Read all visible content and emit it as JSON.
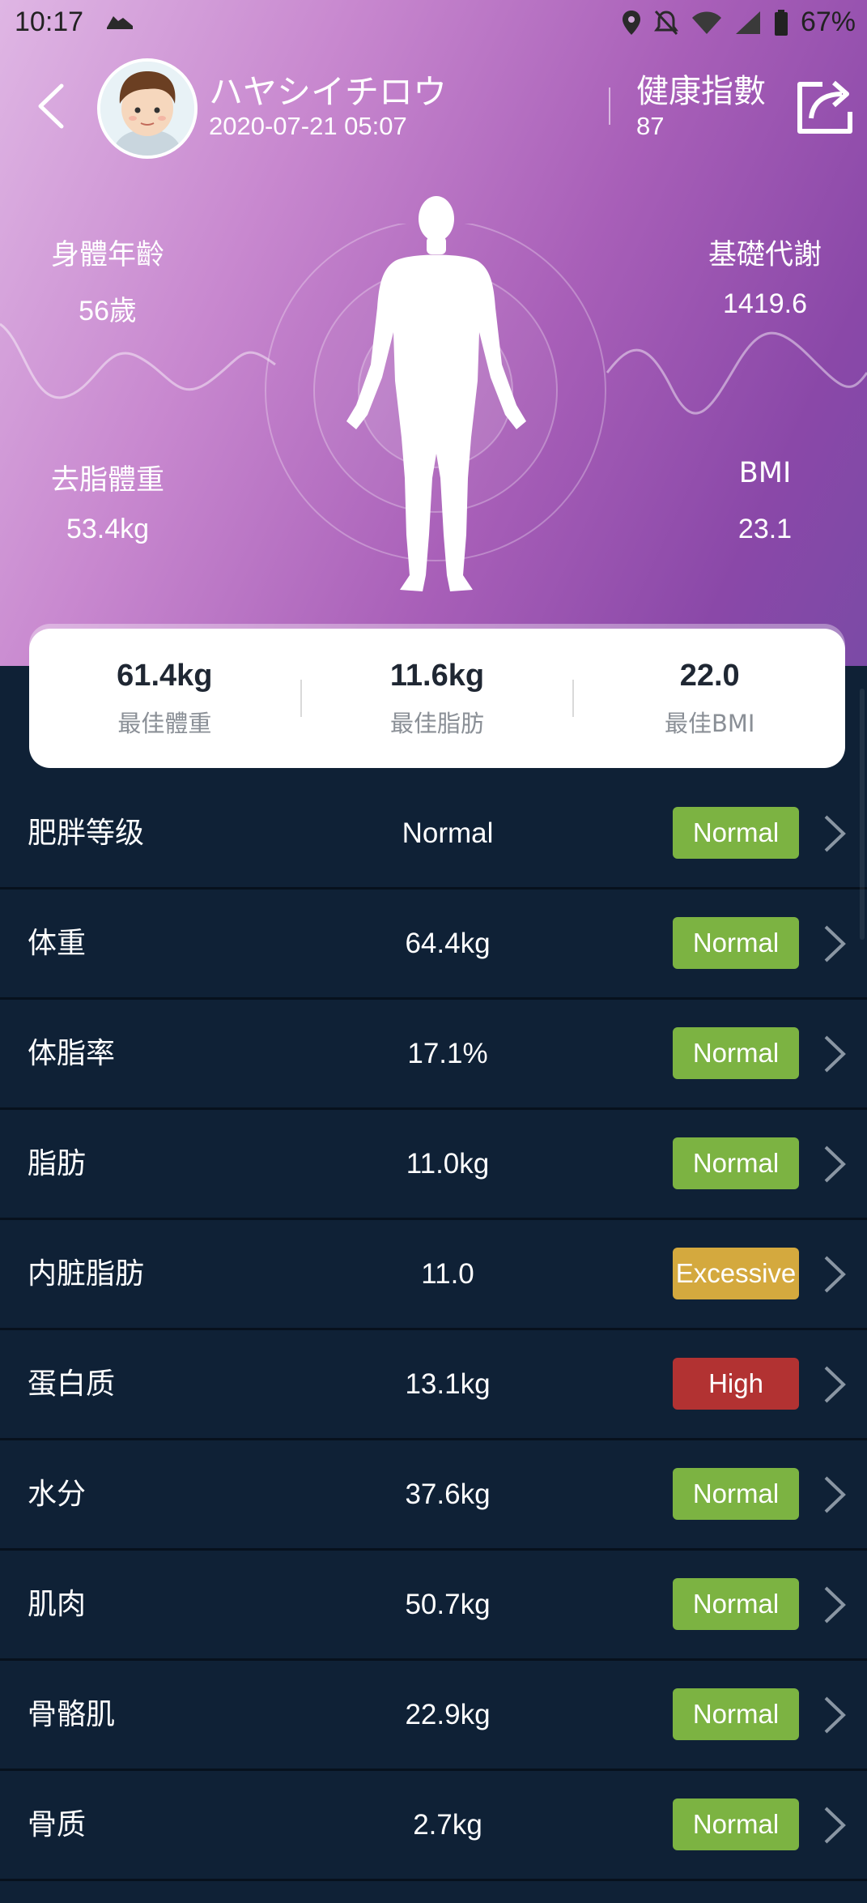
{
  "status_bar": {
    "time": "10:17",
    "battery": "67%",
    "icons": [
      "running-shoe-icon",
      "location-icon",
      "mute-icon",
      "wifi-icon",
      "signal-icon",
      "battery-icon"
    ]
  },
  "header": {
    "user_name": "ハヤシイチロウ",
    "date": "2020-07-21 05:07",
    "health_label": "健康指數",
    "health_value": "87"
  },
  "metrics": {
    "body_age": {
      "label": "身體年齡",
      "value": "56歲"
    },
    "bmr": {
      "label": "基礎代謝",
      "value": "1419.6"
    },
    "lean_mass": {
      "label": "去脂體重",
      "value": "53.4kg"
    },
    "bmi": {
      "label": "BMI",
      "value": "23.1"
    }
  },
  "summary": [
    {
      "value": "61.4kg",
      "label": "最佳體重"
    },
    {
      "value": "11.6kg",
      "label": "最佳脂肪"
    },
    {
      "value": "22.0",
      "label": "最佳BMI"
    }
  ],
  "rows": [
    {
      "name": "肥胖等级",
      "value": "Normal",
      "status": "Normal",
      "status_color": "#7cb342"
    },
    {
      "name": "体重",
      "value": "64.4kg",
      "status": "Normal",
      "status_color": "#7cb342"
    },
    {
      "name": "体脂率",
      "value": "17.1%",
      "status": "Normal",
      "status_color": "#7cb342"
    },
    {
      "name": "脂肪",
      "value": "11.0kg",
      "status": "Normal",
      "status_color": "#7cb342"
    },
    {
      "name": "内脏脂肪",
      "value": "11.0",
      "status": "Excessive",
      "status_color": "#d4a93e"
    },
    {
      "name": "蛋白质",
      "value": "13.1kg",
      "status": "High",
      "status_color": "#b23232"
    },
    {
      "name": "水分",
      "value": "37.6kg",
      "status": "Normal",
      "status_color": "#7cb342"
    },
    {
      "name": "肌肉",
      "value": "50.7kg",
      "status": "Normal",
      "status_color": "#7cb342"
    },
    {
      "name": "骨骼肌",
      "value": "22.9kg",
      "status": "Normal",
      "status_color": "#7cb342"
    },
    {
      "name": "骨质",
      "value": "2.7kg",
      "status": "Normal",
      "status_color": "#7cb342"
    }
  ],
  "colors": {
    "background": "#0f2136",
    "hero_start": "#dfb6e4",
    "hero_end": "#7b4aa6",
    "normal": "#7cb342",
    "excessive": "#d4a93e",
    "high": "#b23232"
  }
}
